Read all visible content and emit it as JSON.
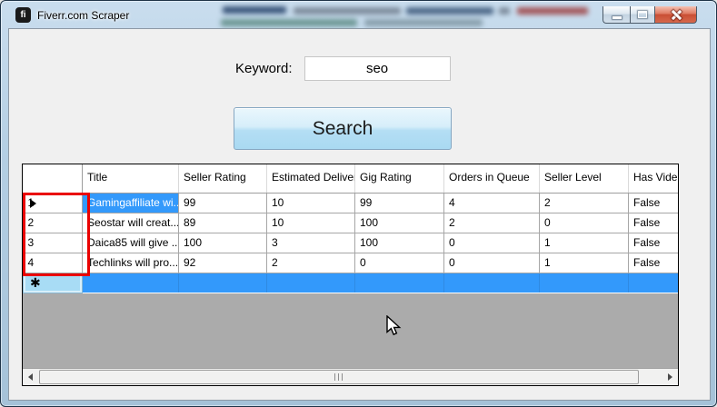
{
  "window": {
    "title": "Fiverr.com Scraper",
    "icon_text": "fi"
  },
  "form": {
    "keyword_label": "Keyword:",
    "keyword_value": "seo",
    "search_button_label": "Search"
  },
  "grid": {
    "columns": [
      "Title",
      "Seller Rating",
      "Estimated Delivery",
      "Gig Rating",
      "Orders in Queue",
      "Seller Level",
      "Has Video"
    ],
    "rows": [
      {
        "num": "1",
        "cells": [
          "Gamingaffiliate wi...",
          "99",
          "10",
          "99",
          "4",
          "2",
          "False"
        ]
      },
      {
        "num": "2",
        "cells": [
          "Seostar will creat...",
          "89",
          "10",
          "100",
          "2",
          "0",
          "False"
        ]
      },
      {
        "num": "3",
        "cells": [
          "Daica85 will give ...",
          "100",
          "3",
          "100",
          "0",
          "1",
          "False"
        ]
      },
      {
        "num": "4",
        "cells": [
          "Techlinks will pro...",
          "92",
          "2",
          "0",
          "0",
          "1",
          "False"
        ]
      }
    ],
    "new_row_marker": "✱"
  },
  "colors": {
    "selection_blue": "#3399fb",
    "annotation_red": "#ea0000",
    "new_row_header_blue": "#a8dcf5",
    "filler_gray": "#ababab",
    "search_button_blue": "#a9d9f2"
  }
}
